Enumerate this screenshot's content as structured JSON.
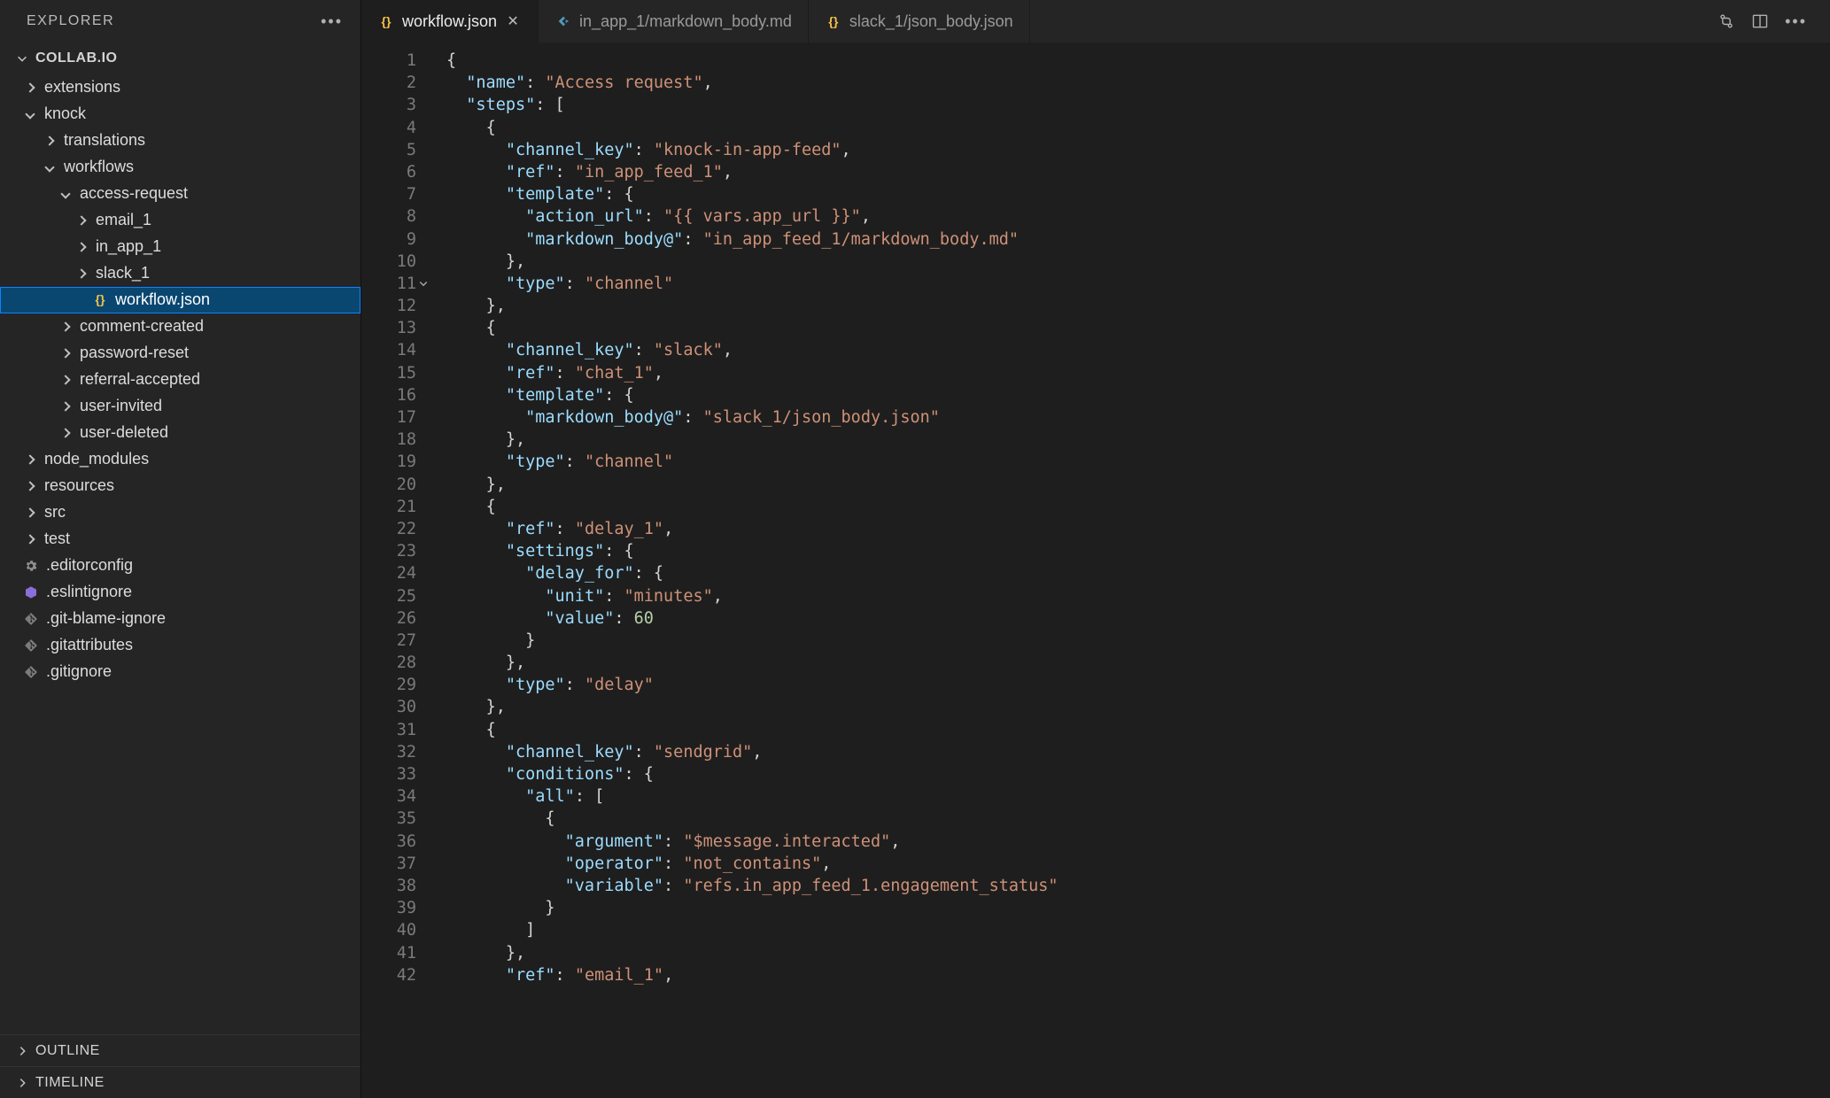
{
  "sidebar": {
    "title": "EXPLORER",
    "project": "COLLAB.IO",
    "outline": "OUTLINE",
    "timeline": "TIMELINE"
  },
  "tree": {
    "extensions": "extensions",
    "knock": "knock",
    "translations": "translations",
    "workflows": "workflows",
    "access_request": "access-request",
    "email_1": "email_1",
    "in_app_1": "in_app_1",
    "slack_1": "slack_1",
    "workflow_json": "workflow.json",
    "comment_created": "comment-created",
    "password_reset": "password-reset",
    "referral_accepted": "referral-accepted",
    "user_invited": "user-invited",
    "user_deleted": "user-deleted",
    "node_modules": "node_modules",
    "resources": "resources",
    "src": "src",
    "test": "test",
    "editorconfig": ".editorconfig",
    "eslintignore": ".eslintignore",
    "git_blame_ignore": ".git-blame-ignore",
    "gitattributes": ".gitattributes",
    "gitignore": ".gitignore"
  },
  "tabs": {
    "t0": {
      "label": "workflow.json"
    },
    "t1": {
      "label": "in_app_1/markdown_body.md"
    },
    "t2": {
      "label": "slack_1/json_body.json"
    }
  },
  "lines": [
    1,
    2,
    3,
    4,
    5,
    6,
    7,
    8,
    9,
    10,
    11,
    12,
    13,
    14,
    15,
    16,
    17,
    18,
    19,
    20,
    21,
    22,
    23,
    24,
    25,
    26,
    27,
    28,
    29,
    30,
    31,
    32,
    33
  ],
  "code": {
    "l1": {
      "p": "{"
    },
    "l2": {
      "p": "  ",
      "k": "\"name\"",
      "c": ": ",
      "v": "\"Access request\"",
      "t": ","
    },
    "l3": {
      "p": "  ",
      "k": "\"steps\"",
      "c": ": ",
      "t": "["
    },
    "l4": {
      "p": "    ",
      "t": "{"
    },
    "l5": {
      "p": "      ",
      "k": "\"channel_key\"",
      "c": ": ",
      "v": "\"knock-in-app-feed\"",
      "t": ","
    },
    "l6": {
      "p": "      ",
      "k": "\"ref\"",
      "c": ": ",
      "v": "\"in_app_feed_1\"",
      "t": ","
    },
    "l7": {
      "p": "      ",
      "k": "\"template\"",
      "c": ": ",
      "t": "{"
    },
    "l8": {
      "p": "        ",
      "k": "\"action_url\"",
      "c": ": ",
      "v": "\"{{ vars.app_url }}\"",
      "t": ","
    },
    "l9": {
      "p": "        ",
      "k": "\"markdown_body@\"",
      "c": ": ",
      "v": "\"in_app_feed_1/markdown_body.md\""
    },
    "l10": {
      "p": "      ",
      "t": "},"
    },
    "l11": {
      "p": "      ",
      "k": "\"type\"",
      "c": ": ",
      "v": "\"channel\""
    },
    "l12": {
      "p": "    ",
      "t": "},"
    },
    "l13": {
      "p": "    ",
      "t": "{"
    },
    "l14": {
      "p": "      ",
      "k": "\"channel_key\"",
      "c": ": ",
      "v": "\"slack\"",
      "t": ","
    },
    "l15": {
      "p": "      ",
      "k": "\"ref\"",
      "c": ": ",
      "v": "\"chat_1\"",
      "t": ","
    },
    "l16": {
      "p": "      ",
      "k": "\"template\"",
      "c": ": ",
      "t": "{"
    },
    "l17": {
      "p": "        ",
      "k": "\"markdown_body@\"",
      "c": ": ",
      "v": "\"slack_1/json_body.json\""
    },
    "l18": {
      "p": "      ",
      "t": "},"
    },
    "l19": {
      "p": "      ",
      "k": "\"type\"",
      "c": ": ",
      "v": "\"channel\""
    },
    "l20": {
      "p": "    ",
      "t": "},"
    },
    "l21": {
      "p": "    ",
      "t": "{"
    },
    "l22": {
      "p": "      ",
      "k": "\"ref\"",
      "c": ": ",
      "v": "\"delay_1\"",
      "t": ","
    },
    "l23": {
      "p": "      ",
      "k": "\"settings\"",
      "c": ": ",
      "t": "{"
    },
    "l24": {
      "p": "        ",
      "k": "\"delay_for\"",
      "c": ": ",
      "t": "{"
    },
    "l25": {
      "p": "          ",
      "k": "\"unit\"",
      "c": ": ",
      "v": "\"minutes\"",
      "t": ","
    },
    "l26": {
      "p": "          ",
      "k": "\"value\"",
      "c": ": ",
      "n": "60"
    },
    "l27": {
      "p": "        ",
      "t": "}"
    },
    "l28": {
      "p": "      ",
      "t": "},"
    },
    "l29": {
      "p": "      ",
      "k": "\"type\"",
      "c": ": ",
      "v": "\"delay\""
    },
    "l30": {
      "p": "    ",
      "t": "},"
    },
    "l31": {
      "p": "    ",
      "t": "{"
    },
    "l32": {
      "p": "      ",
      "k": "\"channel_key\"",
      "c": ": ",
      "v": "\"sendgrid\"",
      "t": ","
    },
    "l33": {
      "p": "      ",
      "k": "\"conditions\"",
      "c": ": ",
      "t": "{"
    },
    "l34": {
      "p": "        ",
      "k": "\"all\"",
      "c": ": ",
      "t": "["
    },
    "l35": {
      "p": "          ",
      "t": "{"
    },
    "l36": {
      "p": "            ",
      "k": "\"argument\"",
      "c": ": ",
      "v": "\"$message.interacted\"",
      "t": ","
    },
    "l37": {
      "p": "            ",
      "k": "\"operator\"",
      "c": ": ",
      "v": "\"not_contains\"",
      "t": ","
    },
    "l38": {
      "p": "            ",
      "k": "\"variable\"",
      "c": ": ",
      "v": "\"refs.in_app_feed_1.engagement_status\""
    },
    "l39": {
      "p": "          ",
      "t": "}"
    },
    "l40": {
      "p": "        ",
      "t": "]"
    },
    "l41": {
      "p": "      ",
      "t": "},"
    },
    "l42": {
      "p": "      ",
      "k": "\"ref\"",
      "c": ": ",
      "v": "\"email_1\"",
      "t": ","
    }
  }
}
